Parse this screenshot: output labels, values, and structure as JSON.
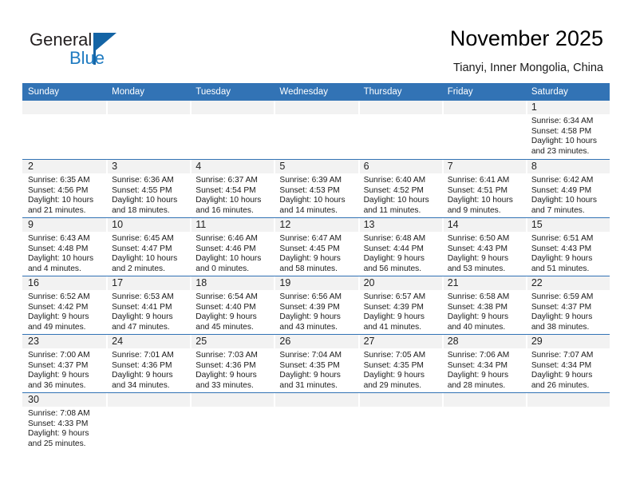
{
  "brand": {
    "name_top": "General",
    "name_bottom": "Blue",
    "triangle_icon": "triangle-icon",
    "accent_color": "#1f7bc1",
    "header_color": "#3273b5"
  },
  "header": {
    "title": "November 2025",
    "subtitle": "Tianyi, Inner Mongolia, China"
  },
  "weekdays": [
    "Sunday",
    "Monday",
    "Tuesday",
    "Wednesday",
    "Thursday",
    "Friday",
    "Saturday"
  ],
  "weeks": [
    [
      {
        "day": ""
      },
      {
        "day": ""
      },
      {
        "day": ""
      },
      {
        "day": ""
      },
      {
        "day": ""
      },
      {
        "day": ""
      },
      {
        "day": "1",
        "sunrise": "Sunrise: 6:34 AM",
        "sunset": "Sunset: 4:58 PM",
        "daylight1": "Daylight: 10 hours",
        "daylight2": "and 23 minutes."
      }
    ],
    [
      {
        "day": "2",
        "sunrise": "Sunrise: 6:35 AM",
        "sunset": "Sunset: 4:56 PM",
        "daylight1": "Daylight: 10 hours",
        "daylight2": "and 21 minutes."
      },
      {
        "day": "3",
        "sunrise": "Sunrise: 6:36 AM",
        "sunset": "Sunset: 4:55 PM",
        "daylight1": "Daylight: 10 hours",
        "daylight2": "and 18 minutes."
      },
      {
        "day": "4",
        "sunrise": "Sunrise: 6:37 AM",
        "sunset": "Sunset: 4:54 PM",
        "daylight1": "Daylight: 10 hours",
        "daylight2": "and 16 minutes."
      },
      {
        "day": "5",
        "sunrise": "Sunrise: 6:39 AM",
        "sunset": "Sunset: 4:53 PM",
        "daylight1": "Daylight: 10 hours",
        "daylight2": "and 14 minutes."
      },
      {
        "day": "6",
        "sunrise": "Sunrise: 6:40 AM",
        "sunset": "Sunset: 4:52 PM",
        "daylight1": "Daylight: 10 hours",
        "daylight2": "and 11 minutes."
      },
      {
        "day": "7",
        "sunrise": "Sunrise: 6:41 AM",
        "sunset": "Sunset: 4:51 PM",
        "daylight1": "Daylight: 10 hours",
        "daylight2": "and 9 minutes."
      },
      {
        "day": "8",
        "sunrise": "Sunrise: 6:42 AM",
        "sunset": "Sunset: 4:49 PM",
        "daylight1": "Daylight: 10 hours",
        "daylight2": "and 7 minutes."
      }
    ],
    [
      {
        "day": "9",
        "sunrise": "Sunrise: 6:43 AM",
        "sunset": "Sunset: 4:48 PM",
        "daylight1": "Daylight: 10 hours",
        "daylight2": "and 4 minutes."
      },
      {
        "day": "10",
        "sunrise": "Sunrise: 6:45 AM",
        "sunset": "Sunset: 4:47 PM",
        "daylight1": "Daylight: 10 hours",
        "daylight2": "and 2 minutes."
      },
      {
        "day": "11",
        "sunrise": "Sunrise: 6:46 AM",
        "sunset": "Sunset: 4:46 PM",
        "daylight1": "Daylight: 10 hours",
        "daylight2": "and 0 minutes."
      },
      {
        "day": "12",
        "sunrise": "Sunrise: 6:47 AM",
        "sunset": "Sunset: 4:45 PM",
        "daylight1": "Daylight: 9 hours",
        "daylight2": "and 58 minutes."
      },
      {
        "day": "13",
        "sunrise": "Sunrise: 6:48 AM",
        "sunset": "Sunset: 4:44 PM",
        "daylight1": "Daylight: 9 hours",
        "daylight2": "and 56 minutes."
      },
      {
        "day": "14",
        "sunrise": "Sunrise: 6:50 AM",
        "sunset": "Sunset: 4:43 PM",
        "daylight1": "Daylight: 9 hours",
        "daylight2": "and 53 minutes."
      },
      {
        "day": "15",
        "sunrise": "Sunrise: 6:51 AM",
        "sunset": "Sunset: 4:43 PM",
        "daylight1": "Daylight: 9 hours",
        "daylight2": "and 51 minutes."
      }
    ],
    [
      {
        "day": "16",
        "sunrise": "Sunrise: 6:52 AM",
        "sunset": "Sunset: 4:42 PM",
        "daylight1": "Daylight: 9 hours",
        "daylight2": "and 49 minutes."
      },
      {
        "day": "17",
        "sunrise": "Sunrise: 6:53 AM",
        "sunset": "Sunset: 4:41 PM",
        "daylight1": "Daylight: 9 hours",
        "daylight2": "and 47 minutes."
      },
      {
        "day": "18",
        "sunrise": "Sunrise: 6:54 AM",
        "sunset": "Sunset: 4:40 PM",
        "daylight1": "Daylight: 9 hours",
        "daylight2": "and 45 minutes."
      },
      {
        "day": "19",
        "sunrise": "Sunrise: 6:56 AM",
        "sunset": "Sunset: 4:39 PM",
        "daylight1": "Daylight: 9 hours",
        "daylight2": "and 43 minutes."
      },
      {
        "day": "20",
        "sunrise": "Sunrise: 6:57 AM",
        "sunset": "Sunset: 4:39 PM",
        "daylight1": "Daylight: 9 hours",
        "daylight2": "and 41 minutes."
      },
      {
        "day": "21",
        "sunrise": "Sunrise: 6:58 AM",
        "sunset": "Sunset: 4:38 PM",
        "daylight1": "Daylight: 9 hours",
        "daylight2": "and 40 minutes."
      },
      {
        "day": "22",
        "sunrise": "Sunrise: 6:59 AM",
        "sunset": "Sunset: 4:37 PM",
        "daylight1": "Daylight: 9 hours",
        "daylight2": "and 38 minutes."
      }
    ],
    [
      {
        "day": "23",
        "sunrise": "Sunrise: 7:00 AM",
        "sunset": "Sunset: 4:37 PM",
        "daylight1": "Daylight: 9 hours",
        "daylight2": "and 36 minutes."
      },
      {
        "day": "24",
        "sunrise": "Sunrise: 7:01 AM",
        "sunset": "Sunset: 4:36 PM",
        "daylight1": "Daylight: 9 hours",
        "daylight2": "and 34 minutes."
      },
      {
        "day": "25",
        "sunrise": "Sunrise: 7:03 AM",
        "sunset": "Sunset: 4:36 PM",
        "daylight1": "Daylight: 9 hours",
        "daylight2": "and 33 minutes."
      },
      {
        "day": "26",
        "sunrise": "Sunrise: 7:04 AM",
        "sunset": "Sunset: 4:35 PM",
        "daylight1": "Daylight: 9 hours",
        "daylight2": "and 31 minutes."
      },
      {
        "day": "27",
        "sunrise": "Sunrise: 7:05 AM",
        "sunset": "Sunset: 4:35 PM",
        "daylight1": "Daylight: 9 hours",
        "daylight2": "and 29 minutes."
      },
      {
        "day": "28",
        "sunrise": "Sunrise: 7:06 AM",
        "sunset": "Sunset: 4:34 PM",
        "daylight1": "Daylight: 9 hours",
        "daylight2": "and 28 minutes."
      },
      {
        "day": "29",
        "sunrise": "Sunrise: 7:07 AM",
        "sunset": "Sunset: 4:34 PM",
        "daylight1": "Daylight: 9 hours",
        "daylight2": "and 26 minutes."
      }
    ],
    [
      {
        "day": "30",
        "sunrise": "Sunrise: 7:08 AM",
        "sunset": "Sunset: 4:33 PM",
        "daylight1": "Daylight: 9 hours",
        "daylight2": "and 25 minutes."
      },
      {
        "day": ""
      },
      {
        "day": ""
      },
      {
        "day": ""
      },
      {
        "day": ""
      },
      {
        "day": ""
      },
      {
        "day": ""
      }
    ]
  ]
}
